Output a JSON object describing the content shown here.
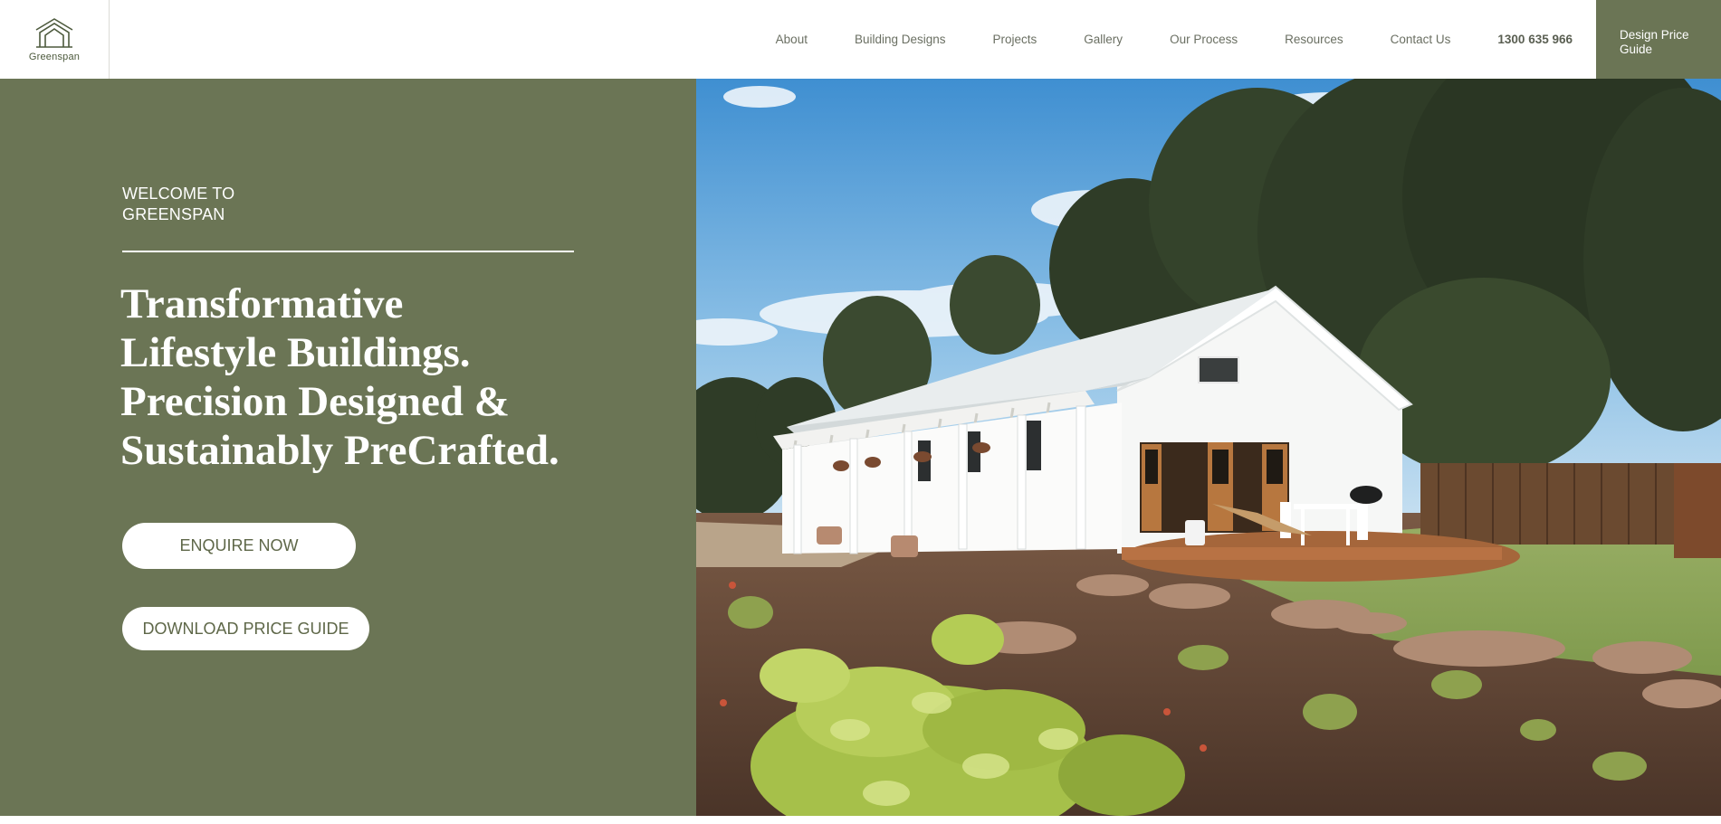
{
  "header": {
    "logo_text": "Greenspan",
    "nav": [
      {
        "label": "About"
      },
      {
        "label": "Building Designs"
      },
      {
        "label": "Projects"
      },
      {
        "label": "Gallery"
      },
      {
        "label": "Our Process"
      },
      {
        "label": "Resources"
      },
      {
        "label": "Contact Us"
      }
    ],
    "phone": "1300 635 966",
    "cta": {
      "line1": "Design Price",
      "line2": "Guide"
    }
  },
  "hero": {
    "welcome_line1": "WELCOME TO",
    "welcome_line2": "GREENSPAN",
    "headline": [
      "Transformative",
      "Lifestyle Buildings.",
      "Precision Designed &",
      "Sustainably PreCrafted."
    ],
    "buttons": {
      "enquire": "ENQUIRE NOW",
      "download": "DOWNLOAD PRICE GUIDE"
    },
    "image_icon": "house-photo"
  },
  "colors": {
    "brand_green": "#6b7555",
    "button_text": "#5e6748",
    "nav_text": "#6a6f62",
    "white": "#ffffff"
  }
}
